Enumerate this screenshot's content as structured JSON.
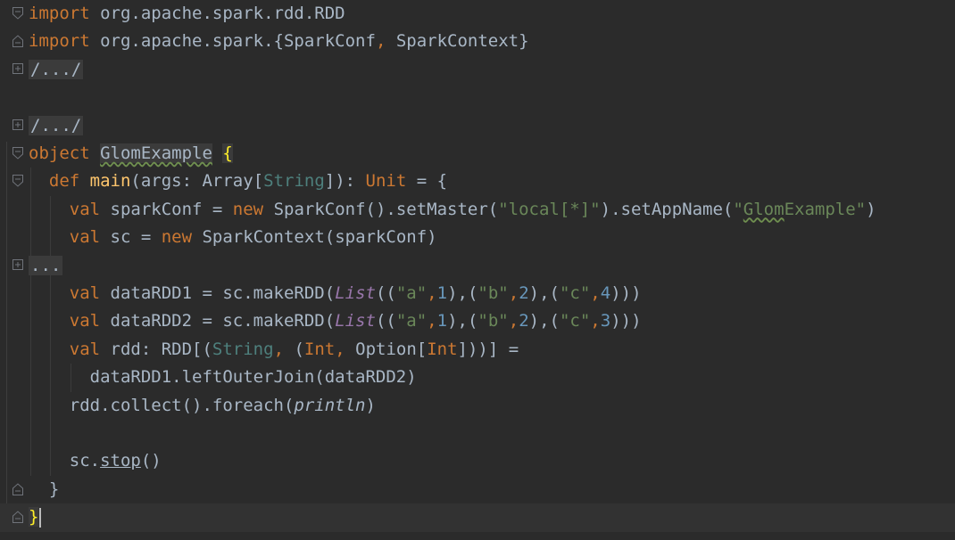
{
  "editor": {
    "lines": [
      {
        "parts": [
          {
            "t": "import",
            "c": "kw"
          },
          {
            "t": " org.apache.spark.rdd.RDD",
            "c": "plain"
          }
        ]
      },
      {
        "parts": [
          {
            "t": "import",
            "c": "kw"
          },
          {
            "t": " org.apache.spark.{SparkConf",
            "c": "plain"
          },
          {
            "t": ",",
            "c": "kw"
          },
          {
            "t": " SparkContext}",
            "c": "plain"
          }
        ]
      },
      {
        "parts": [
          {
            "t": "/.../",
            "c": "collapsed"
          }
        ]
      },
      {
        "parts": []
      },
      {
        "parts": [
          {
            "t": "/.../",
            "c": "collapsed"
          }
        ]
      },
      {
        "parts": [
          {
            "t": "object",
            "c": "kw"
          },
          {
            "t": " ",
            "c": "plain"
          },
          {
            "t": "GlomExample",
            "c": "objname"
          },
          {
            "t": " ",
            "c": "plain"
          },
          {
            "t": "{",
            "c": "brace-match"
          }
        ]
      },
      {
        "parts": [
          {
            "t": "  def",
            "c": "kw"
          },
          {
            "t": " ",
            "c": "plain"
          },
          {
            "t": "main",
            "c": "fn"
          },
          {
            "t": "(args: Array[",
            "c": "plain"
          },
          {
            "t": "String",
            "c": "type"
          },
          {
            "t": "]): ",
            "c": "plain"
          },
          {
            "t": "Unit",
            "c": "kw"
          },
          {
            "t": " = {",
            "c": "plain"
          }
        ]
      },
      {
        "parts": [
          {
            "t": "    val",
            "c": "kw"
          },
          {
            "t": " sparkConf = ",
            "c": "plain"
          },
          {
            "t": "new",
            "c": "kw"
          },
          {
            "t": " SparkConf().setMaster(",
            "c": "plain"
          },
          {
            "t": "\"local[*]\"",
            "c": "str"
          },
          {
            "t": ").setAppName(",
            "c": "plain"
          },
          {
            "t": "\"",
            "c": "str"
          },
          {
            "t": "Glom",
            "c": "str wavy"
          },
          {
            "t": "Example\"",
            "c": "str"
          },
          {
            "t": ")",
            "c": "plain"
          }
        ]
      },
      {
        "parts": [
          {
            "t": "    val",
            "c": "kw"
          },
          {
            "t": " sc = ",
            "c": "plain"
          },
          {
            "t": "new",
            "c": "kw"
          },
          {
            "t": " SparkContext(sparkConf)",
            "c": "plain"
          }
        ]
      },
      {
        "parts": [
          {
            "t": "...",
            "c": "collapsed"
          }
        ]
      },
      {
        "parts": [
          {
            "t": "    val",
            "c": "kw"
          },
          {
            "t": " dataRDD1 = sc.makeRDD(",
            "c": "plain"
          },
          {
            "t": "List",
            "c": "ital"
          },
          {
            "t": "((",
            "c": "plain"
          },
          {
            "t": "\"a\"",
            "c": "str"
          },
          {
            "t": ",",
            "c": "kw"
          },
          {
            "t": "1",
            "c": "num"
          },
          {
            "t": "),(",
            "c": "plain"
          },
          {
            "t": "\"b\"",
            "c": "str"
          },
          {
            "t": ",",
            "c": "kw"
          },
          {
            "t": "2",
            "c": "num"
          },
          {
            "t": "),(",
            "c": "plain"
          },
          {
            "t": "\"c\"",
            "c": "str"
          },
          {
            "t": ",",
            "c": "kw"
          },
          {
            "t": "4",
            "c": "num"
          },
          {
            "t": ")))",
            "c": "plain"
          }
        ]
      },
      {
        "parts": [
          {
            "t": "    val",
            "c": "kw"
          },
          {
            "t": " dataRDD2 = sc.makeRDD(",
            "c": "plain"
          },
          {
            "t": "List",
            "c": "ital"
          },
          {
            "t": "((",
            "c": "plain"
          },
          {
            "t": "\"a\"",
            "c": "str"
          },
          {
            "t": ",",
            "c": "kw"
          },
          {
            "t": "1",
            "c": "num"
          },
          {
            "t": "),(",
            "c": "plain"
          },
          {
            "t": "\"b\"",
            "c": "str"
          },
          {
            "t": ",",
            "c": "kw"
          },
          {
            "t": "2",
            "c": "num"
          },
          {
            "t": "),(",
            "c": "plain"
          },
          {
            "t": "\"c\"",
            "c": "str"
          },
          {
            "t": ",",
            "c": "kw"
          },
          {
            "t": "3",
            "c": "num"
          },
          {
            "t": ")))",
            "c": "plain"
          }
        ]
      },
      {
        "parts": [
          {
            "t": "    val",
            "c": "kw"
          },
          {
            "t": " rdd: RDD[(",
            "c": "plain"
          },
          {
            "t": "String",
            "c": "type"
          },
          {
            "t": ",",
            "c": "kw"
          },
          {
            "t": " (",
            "c": "plain"
          },
          {
            "t": "Int",
            "c": "kw"
          },
          {
            "t": ",",
            "c": "kw"
          },
          {
            "t": " Option[",
            "c": "plain"
          },
          {
            "t": "Int",
            "c": "kw"
          },
          {
            "t": "]))] =",
            "c": "plain"
          }
        ]
      },
      {
        "parts": [
          {
            "t": "      dataRDD1.leftOuterJoin(dataRDD2)",
            "c": "plain"
          }
        ]
      },
      {
        "parts": [
          {
            "t": "    rdd.collect().foreach(",
            "c": "plain"
          },
          {
            "t": "println",
            "c": "ital-plain"
          },
          {
            "t": ")",
            "c": "plain"
          }
        ]
      },
      {
        "parts": []
      },
      {
        "parts": [
          {
            "t": "    sc.",
            "c": "plain"
          },
          {
            "t": "stop",
            "c": "under"
          },
          {
            "t": "()",
            "c": "plain"
          }
        ]
      },
      {
        "parts": [
          {
            "t": "  }",
            "c": "plain"
          }
        ]
      },
      {
        "parts": [
          {
            "t": "}",
            "c": "brace-match"
          }
        ]
      }
    ],
    "folds": [
      {
        "line": 0,
        "kind": "open"
      },
      {
        "line": 1,
        "kind": "close"
      },
      {
        "line": 2,
        "kind": "plus"
      },
      {
        "line": 4,
        "kind": "plus"
      },
      {
        "line": 5,
        "kind": "open"
      },
      {
        "line": 6,
        "kind": "open"
      },
      {
        "line": 9,
        "kind": "plus"
      },
      {
        "line": 17,
        "kind": "close"
      },
      {
        "line": 18,
        "kind": "close"
      }
    ],
    "current_line": 18,
    "colors": {
      "background": "#2b2b2b",
      "keyword": "#cc7832",
      "string": "#6a8759",
      "number": "#6897bb",
      "type": "#4e807d",
      "function": "#ffc66d",
      "text": "#a9b7c6"
    }
  }
}
